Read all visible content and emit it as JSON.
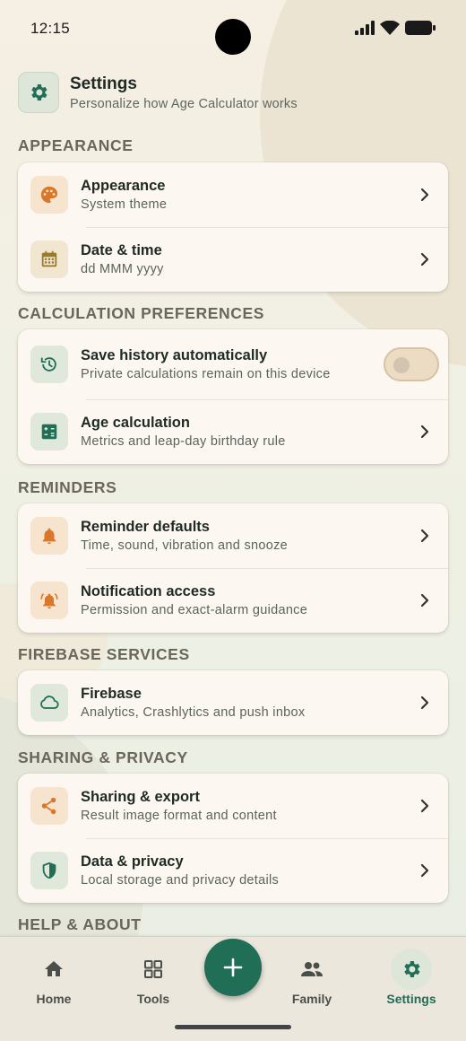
{
  "status_bar": {
    "time": "12:15"
  },
  "header": {
    "title": "Settings",
    "subtitle": "Personalize how Age Calculator works"
  },
  "sections": {
    "appearance": {
      "title": "APPEARANCE",
      "items": [
        {
          "title": "Appearance",
          "subtitle": "System theme",
          "icon": "palette-icon"
        },
        {
          "title": "Date & time",
          "subtitle": "dd MMM yyyy",
          "icon": "calendar-icon"
        }
      ]
    },
    "calculation": {
      "title": "CALCULATION PREFERENCES",
      "items": [
        {
          "title": "Save history automatically",
          "subtitle": "Private calculations remain on this device",
          "icon": "history-icon",
          "toggle": false
        },
        {
          "title": "Age calculation",
          "subtitle": "Metrics and leap-day birthday rule",
          "icon": "calculator-icon"
        }
      ]
    },
    "reminders": {
      "title": "REMINDERS",
      "items": [
        {
          "title": "Reminder defaults",
          "subtitle": "Time, sound, vibration and snooze",
          "icon": "bell-icon"
        },
        {
          "title": "Notification access",
          "subtitle": "Permission and exact-alarm guidance",
          "icon": "alarm-bell-icon"
        }
      ]
    },
    "firebase": {
      "title": "FIREBASE SERVICES",
      "items": [
        {
          "title": "Firebase",
          "subtitle": "Analytics, Crashlytics and push inbox",
          "icon": "cloud-icon"
        }
      ]
    },
    "sharing": {
      "title": "SHARING & PRIVACY",
      "items": [
        {
          "title": "Sharing & export",
          "subtitle": "Result image format and content",
          "icon": "share-icon"
        },
        {
          "title": "Data & privacy",
          "subtitle": "Local storage and privacy details",
          "icon": "shield-icon"
        }
      ]
    },
    "help": {
      "title": "HELP & ABOUT"
    }
  },
  "nav": {
    "items": [
      {
        "label": "Home",
        "icon": "home-icon"
      },
      {
        "label": "Tools",
        "icon": "grid-icon"
      },
      {
        "label": "Family",
        "icon": "people-icon"
      },
      {
        "label": "Settings",
        "icon": "gear-icon",
        "active": true
      }
    ],
    "fab_icon": "plus-icon"
  },
  "colors": {
    "accent": "#1f6e55",
    "orange_icon": "#d9782b",
    "gold_icon": "#9a7a2c",
    "card": "#fcf8f1"
  }
}
